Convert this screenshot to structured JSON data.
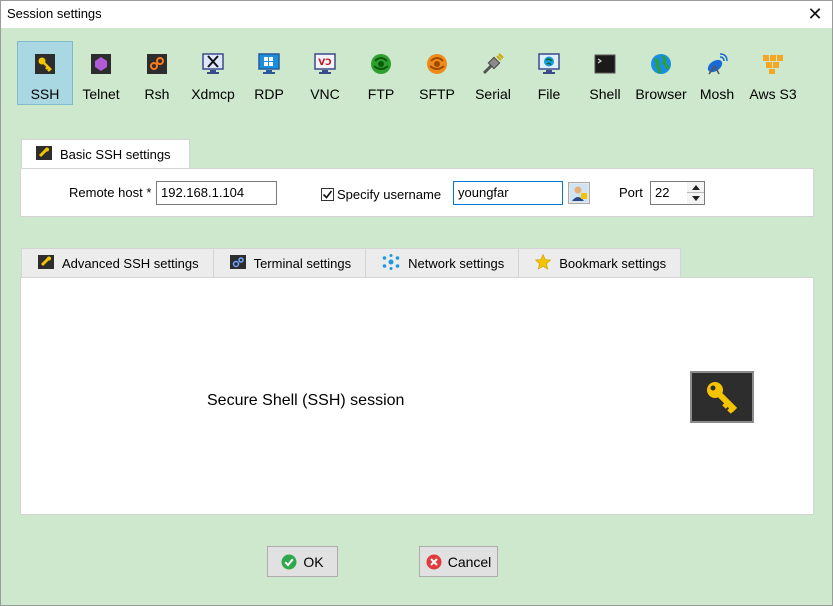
{
  "window": {
    "title": "Session settings"
  },
  "protocols": [
    {
      "label": "SSH",
      "icon": "key-icon",
      "active": true
    },
    {
      "label": "Telnet",
      "icon": "telnet-icon"
    },
    {
      "label": "Rsh",
      "icon": "rsh-icon"
    },
    {
      "label": "Xdmcp",
      "icon": "xdmcp-icon"
    },
    {
      "label": "RDP",
      "icon": "rdp-icon"
    },
    {
      "label": "VNC",
      "icon": "vnc-icon"
    },
    {
      "label": "FTP",
      "icon": "ftp-icon"
    },
    {
      "label": "SFTP",
      "icon": "sftp-icon"
    },
    {
      "label": "Serial",
      "icon": "serial-icon"
    },
    {
      "label": "File",
      "icon": "file-icon"
    },
    {
      "label": "Shell",
      "icon": "shell-icon"
    },
    {
      "label": "Browser",
      "icon": "browser-icon"
    },
    {
      "label": "Mosh",
      "icon": "mosh-icon"
    },
    {
      "label": "Aws S3",
      "icon": "aws-s3-icon"
    }
  ],
  "basic": {
    "tab_label": "Basic SSH settings",
    "remote_host_label": "Remote host *",
    "remote_host_value": "192.168.1.104",
    "specify_username_label": "Specify username",
    "specify_username_checked": true,
    "username_value": "youngfar",
    "port_label": "Port",
    "port_value": "22"
  },
  "tabs": [
    {
      "label": "Advanced SSH settings",
      "icon": "wrench-icon"
    },
    {
      "label": "Terminal settings",
      "icon": "terminal-settings-icon"
    },
    {
      "label": "Network settings",
      "icon": "network-icon"
    },
    {
      "label": "Bookmark settings",
      "icon": "star-icon"
    }
  ],
  "panel": {
    "description": "Secure Shell (SSH) session"
  },
  "buttons": {
    "ok_label": "OK",
    "cancel_label": "Cancel"
  },
  "colors": {
    "background": "#cde8cd",
    "active_protocol": "#a9d7e2",
    "key_yellow": "#f5c400"
  }
}
